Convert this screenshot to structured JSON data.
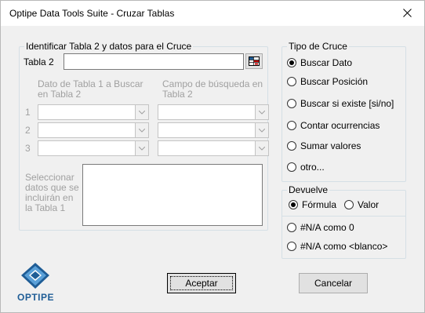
{
  "window": {
    "title": "Optipe Data Tools Suite - Cruzar Tablas"
  },
  "identify_group": {
    "legend": "Identificar Tabla 2 y datos para el Cruce",
    "tabla2_label": "Tabla 2",
    "tabla2_value": "",
    "col1_header": "Dato de Tabla 1 a Buscar en Tabla 2",
    "col2_header": "Campo de búsqueda en Tabla 2",
    "rows": [
      {
        "num": "1",
        "dato": "",
        "campo": ""
      },
      {
        "num": "2",
        "dato": "",
        "campo": ""
      },
      {
        "num": "3",
        "dato": "",
        "campo": ""
      }
    ],
    "select_label": "Seleccionar datos que se incluirán en la Tabla 1"
  },
  "tipo_cruce": {
    "legend": "Tipo de Cruce",
    "options": [
      {
        "label": "Buscar Dato",
        "checked": true
      },
      {
        "label": "Buscar Posición",
        "checked": false
      },
      {
        "label": "Buscar si existe [si/no]",
        "checked": false
      },
      {
        "label": "Contar ocurrencias",
        "checked": false
      },
      {
        "label": "Sumar valores",
        "checked": false
      },
      {
        "label": "otro...",
        "checked": false
      }
    ]
  },
  "devuelve": {
    "legend": "Devuelve",
    "formula_label": "Fórmula",
    "formula_checked": true,
    "valor_label": "Valor",
    "valor_checked": false,
    "na_cero_label": "#N/A como 0",
    "na_blanco_label": "#N/A como <blanco>"
  },
  "buttons": {
    "accept": "Aceptar",
    "cancel": "Cancelar"
  },
  "logo": {
    "text": "OPTIPE"
  },
  "colors": {
    "logo_blue": "#1f5d96",
    "logo_light": "#5aa0d8"
  }
}
